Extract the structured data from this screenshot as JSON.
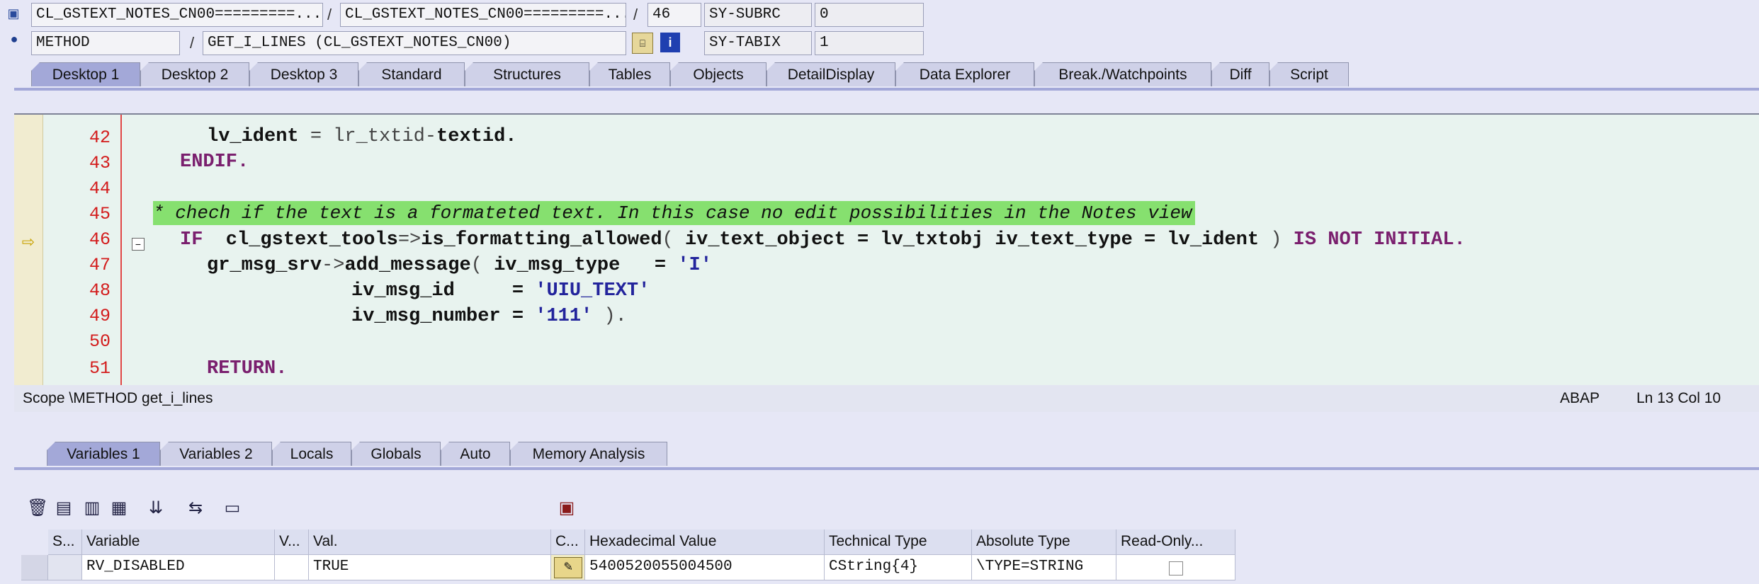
{
  "header": {
    "row1": {
      "program": "CL_GSTEXT_NOTES_CN00=========...",
      "include": "CL_GSTEXT_NOTES_CN00=========...",
      "line": "46",
      "sy_label": "SY-SUBRC",
      "sy_value": "0"
    },
    "row2": {
      "event_type": "METHOD",
      "event": "GET_I_LINES (CL_GSTEXT_NOTES_CN00)",
      "sy_label": "SY-TABIX",
      "sy_value": "1"
    },
    "separator": "/"
  },
  "tabs": [
    {
      "label": "Desktop 1",
      "active": true
    },
    {
      "label": "Desktop 2"
    },
    {
      "label": "Desktop 3"
    },
    {
      "label": "Standard"
    },
    {
      "label": "Structures"
    },
    {
      "label": "Tables"
    },
    {
      "label": "Objects"
    },
    {
      "label": "DetailDisplay"
    },
    {
      "label": "Data Explorer"
    },
    {
      "label": "Break./Watchpoints"
    },
    {
      "label": "Diff"
    },
    {
      "label": "Script"
    }
  ],
  "code": {
    "line_numbers": [
      "42",
      "43",
      "44",
      "45",
      "46",
      "47",
      "48",
      "49",
      "50",
      "51"
    ],
    "comment": "* chech if the text is a formateted text. In this case no edit possibilities in the Notes view",
    "l42": {
      "a": "lv_ident",
      "b": " = lr_txtid",
      "c": "-",
      "d": "textid."
    },
    "l43": {
      "kw": "ENDIF."
    },
    "l46": {
      "kw1": "IF",
      "a": "  cl_gstext_tools",
      "arrow": "=>",
      "b": "is_formatting_allowed",
      "p1": "( ",
      "c": "iv_text_object = lv_txtobj iv_text_type = lv_ident ",
      "p2": ")",
      "kw2": " IS NOT INITIAL."
    },
    "l47": {
      "a": "gr_msg_srv",
      "arrow": "->",
      "b": "add_message",
      "p1": "( ",
      "c": "iv_msg_type   = ",
      "s": "'I'"
    },
    "l48": {
      "c": "iv_msg_id     = ",
      "s": "'UIU_TEXT'"
    },
    "l49": {
      "c": "iv_msg_number = ",
      "s": "'111'",
      "p": " )."
    },
    "l51": {
      "kw": "RETURN."
    }
  },
  "status": {
    "scope": "Scope \\METHOD get_i_lines",
    "language": "ABAP",
    "position": "Ln  13 Col  10"
  },
  "bottom_tabs": [
    {
      "label": "Variables 1",
      "active": true
    },
    {
      "label": "Variables 2"
    },
    {
      "label": "Locals"
    },
    {
      "label": "Globals"
    },
    {
      "label": "Auto"
    },
    {
      "label": "Memory Analysis"
    }
  ],
  "grid": {
    "headers": [
      "S...",
      "Variable",
      "V...",
      "Val.",
      "C...",
      "Hexadecimal Value",
      "Technical Type",
      "Absolute Type",
      "Read-Only..."
    ],
    "rows": [
      {
        "variable": "RV_DISABLED",
        "value": "TRUE",
        "hex": "5400520055004500",
        "technical_type": "CString{4}",
        "absolute_type": "\\TYPE=STRING"
      }
    ]
  },
  "icons": [
    "monitor-icon",
    "method-icon",
    "program-icon",
    "info-icon",
    "trash-icon",
    "detail-icon",
    "detail-alt-icon",
    "save-list-icon",
    "filter-icon",
    "sort-icon",
    "folder-icon",
    "save-icon",
    "edit-pencil-icon",
    "arrow-indicator-icon"
  ],
  "colors": {
    "background": "#e6e7f6",
    "code_background": "#e8f3ef",
    "comment_highlight": "#86e06f",
    "keyword": "#7a1f6e",
    "string": "#23249c",
    "line_number": "#d31c1c",
    "active_tab": "#a3a8d8"
  }
}
